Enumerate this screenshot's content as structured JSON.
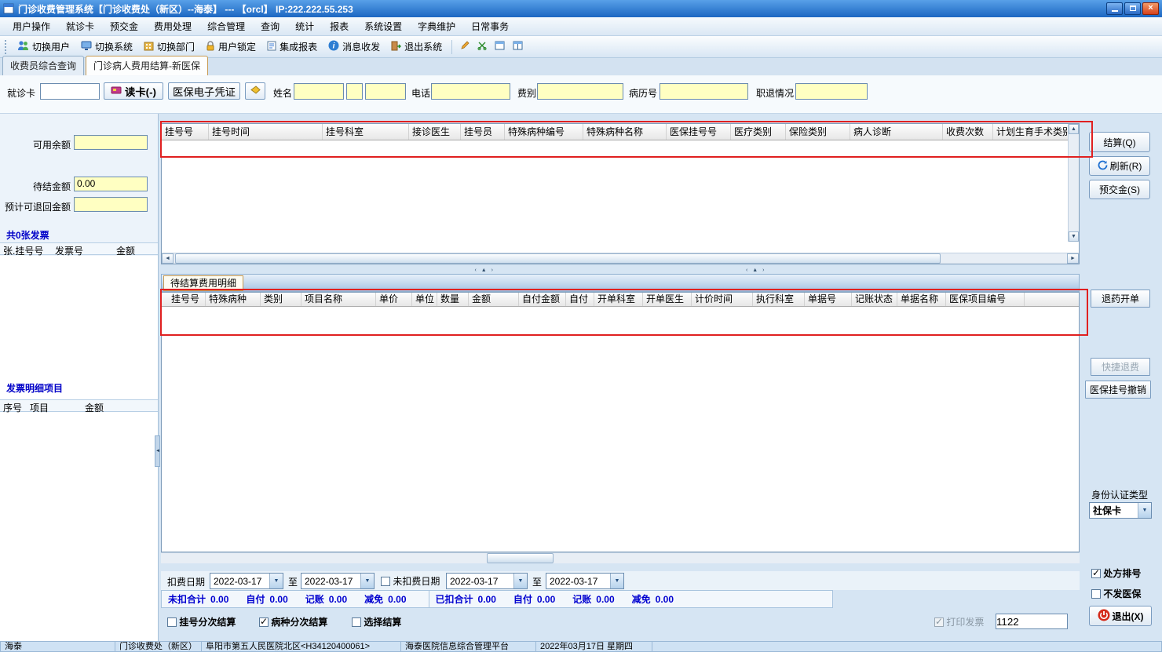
{
  "window": {
    "title": "门诊收费管理系统【门诊收费处（新区）--海泰】 --- 【orcl】  IP:222.222.55.253"
  },
  "menu": {
    "items": [
      "用户操作",
      "就诊卡",
      "预交金",
      "费用处理",
      "综合管理",
      "查询",
      "统计",
      "报表",
      "系统设置",
      "字典维护",
      "日常事务"
    ]
  },
  "toolbar": {
    "items": [
      "切换用户",
      "切换系统",
      "切换部门",
      "用户锁定",
      "集成报表",
      "消息收发",
      "退出系统"
    ]
  },
  "tabs": {
    "items": [
      "收费员综合查询",
      "门诊病人费用结算-新医保"
    ],
    "active_index": 1
  },
  "patient_form": {
    "card_label": "就诊卡",
    "card_value": "",
    "read_card_button": "读卡(-)",
    "ehc_button": "医保电子凭证",
    "name_label": "姓名",
    "name_value": "",
    "phone_label": "电话",
    "phone_value": "",
    "fee_type_label": "费别",
    "fee_type_value": "",
    "record_no_label": "病历号",
    "record_no_value": "",
    "retire_label": "职退情况",
    "retire_value": ""
  },
  "left_panel": {
    "available_balance_label": "可用余额",
    "available_balance_value": "",
    "pending_amount_label": "待结金额",
    "pending_amount_value": "0.00",
    "refund_label": "预计可退回金额",
    "refund_value": "",
    "invoice_count": "共0张发票",
    "invoice_headers": [
      "张.挂号号",
      "发票号",
      "金额"
    ],
    "invoice_detail_title": "发票明细项目",
    "invoice_detail_headers": [
      "序号",
      "项目",
      "金额"
    ]
  },
  "registration_table": {
    "headers": [
      "挂号号",
      "挂号时间",
      "挂号科室",
      "接诊医生",
      "挂号员",
      "特殊病种编号",
      "特殊病种名称",
      "医保挂号号",
      "医疗类别",
      "保险类别",
      "病人诊断",
      "收费次数",
      "计划生育手术类别"
    ],
    "rows": []
  },
  "detail_section": {
    "tab": "待结算费用明细",
    "headers": [
      "挂号号",
      "特殊病种",
      "类别",
      "项目名称",
      "单价",
      "单位",
      "数量",
      "金额",
      "自付金额",
      "自付",
      "开单科室",
      "开单医生",
      "计价时间",
      "执行科室",
      "单据号",
      "记账状态",
      "单据名称",
      "医保项目编号"
    ],
    "rows": []
  },
  "right_actions": {
    "settle": "结算(Q)",
    "refresh": "刷新(R)",
    "deposit": "预交金(S)",
    "drug_return": "退药开单",
    "quick_refund": "快捷退费",
    "cancel_reg": "医保挂号撤销",
    "id_type_label": "身份认证类型",
    "id_type_value": "社保卡",
    "rx_number_label": "处方排号",
    "no_insurance_label": "不发医保",
    "exit": "退出(X)"
  },
  "filters": {
    "deduct_date_label": "扣费日期",
    "to_label": "至",
    "deduct_from": "2022-03-17",
    "deduct_to": "2022-03-17",
    "undeduct_label": "未扣费日期",
    "undeduct_from": "2022-03-17",
    "undeduct_to": "2022-03-17"
  },
  "totals": {
    "undeducted": [
      {
        "label": "未扣合计",
        "value": "0.00"
      },
      {
        "label": "自付",
        "value": "0.00"
      },
      {
        "label": "记账",
        "value": "0.00"
      },
      {
        "label": "减免",
        "value": "0.00"
      }
    ],
    "deducted": [
      {
        "label": "已扣合计",
        "value": "0.00"
      },
      {
        "label": "自付",
        "value": "0.00"
      },
      {
        "label": "记账",
        "value": "0.00"
      },
      {
        "label": "减免",
        "value": "0.00"
      }
    ]
  },
  "settle_options": {
    "by_registration": "挂号分次结算",
    "by_disease": "病种分次结算",
    "select_settle": "选择结算",
    "print_invoice": "打印发票",
    "invoice_no": "1122"
  },
  "checkbox_states": {
    "undeduct_date": false,
    "by_registration": false,
    "by_disease": true,
    "select_settle": false,
    "print_invoice": true,
    "rx_number": true,
    "no_insurance": false
  },
  "status_bar": {
    "items": [
      "海泰",
      "门诊收费处（新区）",
      "阜阳市第五人民医院北区<H34120400061>",
      "海泰医院信息综合管理平台",
      "2022年03月17日 星期四",
      ""
    ]
  }
}
